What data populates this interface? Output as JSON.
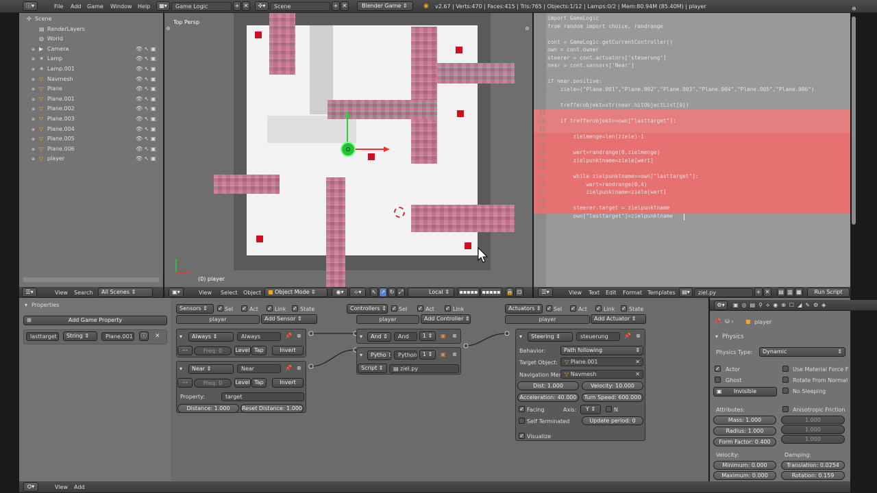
{
  "topbar": {
    "menus": [
      "File",
      "Add",
      "Game",
      "Window",
      "Help"
    ],
    "layout": "Game Logic",
    "scene": "Scene",
    "engine": "Blender Game",
    "stats": "v2.67 | Verts:470 | Faces:415 | Tris:765 | Objects:1/12 | Lamps:0/2 | Mem:80.94M (85.40M) | player"
  },
  "outliner": {
    "items": [
      {
        "label": "Scene",
        "level": 0,
        "icon": "scene-icon"
      },
      {
        "label": "RenderLayers",
        "level": 1,
        "icon": "renderlayers-icon"
      },
      {
        "label": "World",
        "level": 1,
        "icon": "world-icon"
      },
      {
        "label": "Camera",
        "level": 1,
        "icon": "camera-icon"
      },
      {
        "label": "Lamp",
        "level": 1,
        "icon": "lamp-icon"
      },
      {
        "label": "Lamp.001",
        "level": 1,
        "icon": "lamp-icon"
      },
      {
        "label": "Navmesh",
        "level": 1,
        "icon": "mesh-icon"
      },
      {
        "label": "Plane",
        "level": 1,
        "icon": "mesh-icon"
      },
      {
        "label": "Plane.001",
        "level": 1,
        "icon": "mesh-icon"
      },
      {
        "label": "Plane.002",
        "level": 1,
        "icon": "mesh-icon"
      },
      {
        "label": "Plane.003",
        "level": 1,
        "icon": "mesh-icon"
      },
      {
        "label": "Plane.004",
        "level": 1,
        "icon": "mesh-icon"
      },
      {
        "label": "Plane.005",
        "level": 1,
        "icon": "mesh-icon"
      },
      {
        "label": "Plane.006",
        "level": 1,
        "icon": "mesh-icon"
      },
      {
        "label": "player",
        "level": 1,
        "icon": "mesh-icon"
      }
    ],
    "footer": {
      "view": "View",
      "search": "Search",
      "scenes": "All Scenes"
    }
  },
  "viewport": {
    "label": "Top Persp",
    "object": "(0) player",
    "menus": [
      "View",
      "Select",
      "Object"
    ],
    "mode": "Object Mode",
    "orientation": "Local"
  },
  "text_editor": {
    "menus": [
      "View",
      "Text",
      "Edit",
      "Format",
      "Templates"
    ],
    "filename": "ziel.py",
    "run": "Run Script",
    "lines": [
      {
        "n": "1",
        "t": "import GameLogic"
      },
      {
        "n": "2",
        "t": "from random import choice, randrange"
      },
      {
        "n": "3",
        "t": ""
      },
      {
        "n": "4",
        "t": "cont = GameLogic.getCurrentController()"
      },
      {
        "n": "5",
        "t": "own = cont.owner"
      },
      {
        "n": "6",
        "t": "steerer = cont.actuators['steuerung']"
      },
      {
        "n": "7",
        "t": "near = cont.sensors['Near']"
      },
      {
        "n": "8",
        "t": ""
      },
      {
        "n": "9",
        "t": "if near.positive:"
      },
      {
        "n": "10",
        "t": "    ziele=(\"Plane.001\",\"Plane.002\",\"Plane.003\",\"Plane.004\",\"Plane.005\",\"Plane.006\")"
      },
      {
        "n": "11",
        "t": ""
      },
      {
        "n": "12",
        "t": "    trefferobjekt=str(near.hitObjectList[0])"
      },
      {
        "n": "13",
        "t": ""
      },
      {
        "n": "14",
        "t": "    if trefferobjekt==own[\"lasttarget\"]:"
      },
      {
        "n": "15",
        "t": ""
      },
      {
        "n": "16",
        "t": "        zielmenge=len(ziele)-1"
      },
      {
        "n": "17",
        "t": ""
      },
      {
        "n": "18",
        "t": "        wert=randrange(0,zielmenge)"
      },
      {
        "n": "19",
        "t": "        zielpunktname=ziele[wert]"
      },
      {
        "n": "20",
        "t": ""
      },
      {
        "n": "21",
        "t": "        while zielpunktname==own[\"lasttarget\"]:"
      },
      {
        "n": "22",
        "t": "            wert=randrange(0,4)"
      },
      {
        "n": "23",
        "t": "            zielpunktname=ziele[wert]"
      },
      {
        "n": "24",
        "t": ""
      },
      {
        "n": "25",
        "t": "        steerer.target = zielpunktname"
      },
      {
        "n": "26",
        "t": "        own[\"lasttarget\"]=zielpunktname"
      }
    ]
  },
  "properties": {
    "title": "Properties",
    "add_game_property": "Add Game Property",
    "prop_name": "lasttarget",
    "prop_type": "String",
    "prop_value": "Plane.001"
  },
  "logic": {
    "sensors": {
      "label": "Sensors",
      "owner": "player",
      "add": "Add Sensor",
      "sel": "Sel",
      "act": "Act",
      "link": "Link",
      "state": "State",
      "always_type": "Always",
      "always_name": "Always",
      "freq": "Freq: 0",
      "level": "Level",
      "tap": "Tap",
      "invert": "Invert",
      "near_type": "Near",
      "near_name": "Near",
      "property_label": "Property:",
      "property_value": "target",
      "distance": "Distance: 1.000",
      "reset_distance": "Reset Distance: 1.000"
    },
    "controllers": {
      "label": "Controllers",
      "owner": "player",
      "add": "Add Controller",
      "sel": "Sel",
      "act": "Act",
      "link": "Link",
      "and_type": "And",
      "and_name": "And",
      "and_state": "1",
      "py_type": "Pytho",
      "py_name": "Python",
      "py_state": "1",
      "script_mode": "Script",
      "script_file": "ziel.py"
    },
    "actuators": {
      "label": "Actuators",
      "owner": "player",
      "add": "Add Actuator",
      "sel": "Sel",
      "act": "Act",
      "link": "Link",
      "state": "State",
      "steer_type": "Steering",
      "steer_name": "steuerung",
      "behavior_label": "Behavior:",
      "behavior": "Path following",
      "target_label": "Target Object:",
      "target": "Plane.001",
      "navmesh_label": "Navigation Mesh",
      "navmesh": "Navmesh",
      "dist": "Dist: 1.000",
      "velocity": "Velocity: 10.000",
      "accel": "Acceleration: 40.000",
      "turn": "Turn Speed: 600.000",
      "facing": "Facing",
      "axis_label": "Axis:",
      "axis": "Y",
      "n": "N",
      "self_term": "Self Terminated",
      "update": "Update period: 0",
      "visualize": "Visualize"
    }
  },
  "physics_panel": {
    "object": "player",
    "section": "Physics",
    "type_label": "Physics Type:",
    "type": "Dynamic",
    "actor": "Actor",
    "ghost": "Ghost",
    "invisible": "Invisible",
    "use_material": "Use Material Force F",
    "rotate_normal": "Rotate From Normal",
    "no_sleeping": "No Sleeping",
    "attributes": "Attributes:",
    "mass": "Mass: 1.000",
    "radius": "Radius: 1.000",
    "form_factor": "Form Factor: 0.400",
    "aniso": "Anisotropic Friction",
    "aniso_vals": [
      "1.000",
      "1.000",
      "1.000"
    ],
    "velocity": "Velocity:",
    "minimum": "Minimum: 0.000",
    "maximum": "Maximum: 0.000",
    "damping": "Damping:",
    "translation": "Translation: 0.0254",
    "rotation": "Rotation: 0.159"
  },
  "bottom_bar": {
    "view": "View",
    "add": "Add"
  },
  "colors": {
    "highlight": "#f27a7a",
    "code_bg": "#999999",
    "viewport_bg": "#6e6e6e",
    "floor": "#f2f2f2",
    "target": "#d40c1f",
    "player": "#22c33a"
  }
}
